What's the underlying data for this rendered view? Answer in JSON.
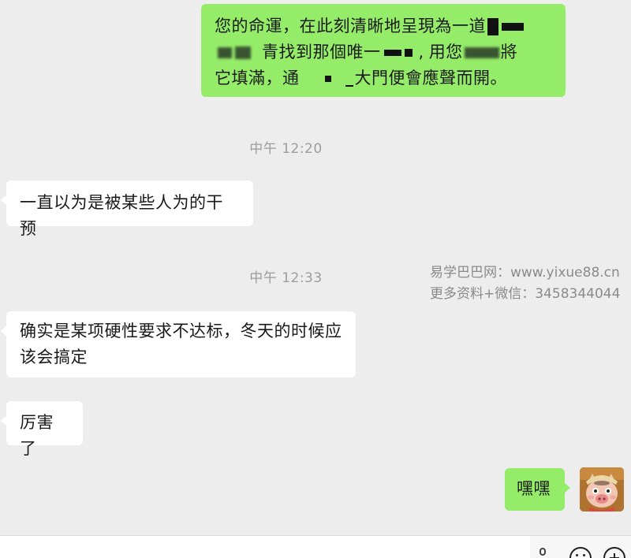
{
  "messages": [
    {
      "id": "m1",
      "direction": "outgoing",
      "line1": "您的命運，在此刻清晰地呈現為一道",
      "line2a": "青找到那個唯一",
      "line2b": "用您",
      "line2c": "將",
      "line3a": "它填滿，通",
      "line3b": "大門便會應聲而開。"
    },
    {
      "id": "m2",
      "direction": "incoming",
      "text": "一直以为是被某些人为的干预"
    },
    {
      "id": "m3",
      "direction": "incoming",
      "line1": "确实是某项硬性要求不达标，冬天的时候应",
      "line2": "该会搞定"
    },
    {
      "id": "m4",
      "direction": "incoming",
      "text": "厉害了"
    },
    {
      "id": "m5",
      "direction": "outgoing",
      "text": "嘿嘿"
    }
  ],
  "timestamps": [
    "中午 12:20",
    "中午 12:33"
  ],
  "watermark": {
    "line1": "易学巴巴网：www.yixue88.cn",
    "line2": "更多资料+微信：3458344044"
  },
  "icons": [
    "voice-icon",
    "emoji-icon",
    "plus-icon",
    "avatar"
  ],
  "colors": {
    "background": "#ededed",
    "outgoing_bubble": "#95ec69",
    "incoming_bubble": "#ffffff",
    "timestamp": "#9c9c9c"
  }
}
